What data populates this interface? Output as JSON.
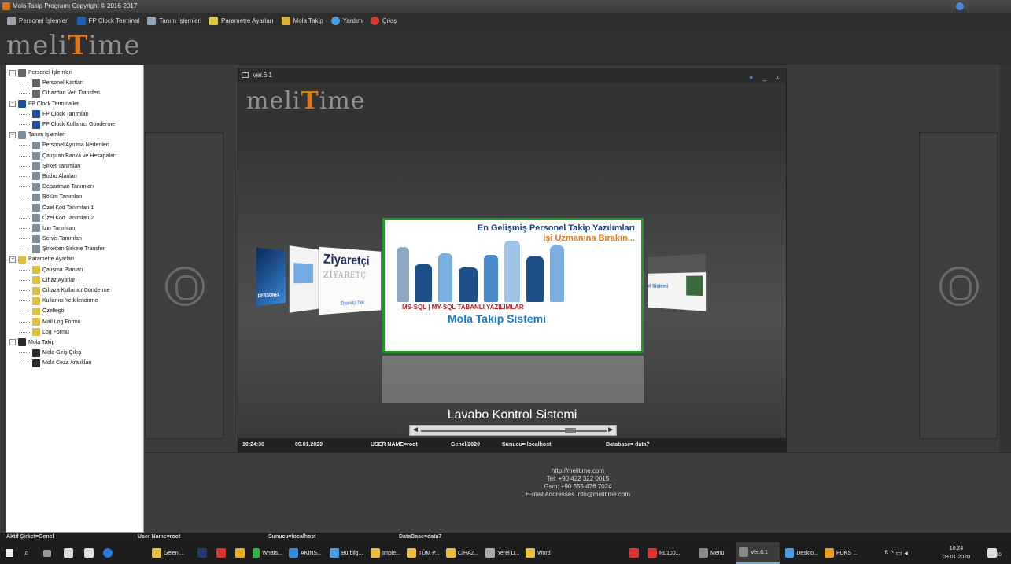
{
  "window": {
    "title": "Mola Takip Programı Copyright © 2016-2017"
  },
  "menu": [
    {
      "label": "Personel İşlemleri",
      "icon": "person-icon",
      "color": "#9aa3ad"
    },
    {
      "label": "FP Clock Terminal",
      "icon": "terminal-icon",
      "color": "#1f5fb0"
    },
    {
      "label": "Tanım İşlemleri",
      "icon": "definitions-icon",
      "color": "#8fa5b8"
    },
    {
      "label": "Parametre Ayarları",
      "icon": "folder-icon",
      "color": "#e6c34a"
    },
    {
      "label": "Mola Takip",
      "icon": "people-icon",
      "color": "#d8b03a"
    },
    {
      "label": "Yardım",
      "icon": "help-icon",
      "color": "#4a9be0"
    },
    {
      "label": "Çıkış",
      "icon": "exit-icon",
      "color": "#d83a2a"
    }
  ],
  "logo": {
    "pre": "meli",
    "t": "T",
    "post": "ime"
  },
  "tree": [
    {
      "label": "Personel İşlemleri",
      "level": 0,
      "expander": "−",
      "icon": "person-icon",
      "color": "#666"
    },
    {
      "label": "Personel Kartları",
      "level": 1,
      "icon": "person-icon",
      "color": "#666"
    },
    {
      "label": "Cihazdan Veri Transferi",
      "level": 1,
      "icon": "person-icon",
      "color": "#666"
    },
    {
      "label": "FP Clock Terminaller",
      "level": 0,
      "expander": "−",
      "icon": "terminal-icon",
      "color": "#1f4f9a"
    },
    {
      "label": "FP Clock Tanımları",
      "level": 1,
      "icon": "terminal-icon",
      "color": "#1f4f9a"
    },
    {
      "label": "FP Clock Kullanıcı Gönderme",
      "level": 1,
      "icon": "terminal-icon",
      "color": "#1f4f9a"
    },
    {
      "label": "Tanım İşlemleri",
      "level": 0,
      "expander": "−",
      "icon": "definitions-icon",
      "color": "#7c8e9e"
    },
    {
      "label": "Personel Ayrılma Nedenleri",
      "level": 1,
      "icon": "definitions-icon",
      "color": "#7c8e9e"
    },
    {
      "label": "Çalışılan Banka ve Hesapaları",
      "level": 1,
      "icon": "definitions-icon",
      "color": "#7c8e9e"
    },
    {
      "label": "Şirket Tanımları",
      "level": 1,
      "icon": "definitions-icon",
      "color": "#7c8e9e"
    },
    {
      "label": "Bodro Alanları",
      "level": 1,
      "icon": "definitions-icon",
      "color": "#7c8e9e"
    },
    {
      "label": "Departman Tanımları",
      "level": 1,
      "icon": "definitions-icon",
      "color": "#7c8e9e"
    },
    {
      "label": "Bölüm Tanımları",
      "level": 1,
      "icon": "definitions-icon",
      "color": "#7c8e9e"
    },
    {
      "label": "Özel Kod Tanımları 1",
      "level": 1,
      "icon": "definitions-icon",
      "color": "#7c8e9e"
    },
    {
      "label": "Özel Kod Tanımları 2",
      "level": 1,
      "icon": "definitions-icon",
      "color": "#7c8e9e"
    },
    {
      "label": "İzin Tanımları",
      "level": 1,
      "icon": "definitions-icon",
      "color": "#7c8e9e"
    },
    {
      "label": "Servis Tanımları",
      "level": 1,
      "icon": "definitions-icon",
      "color": "#7c8e9e"
    },
    {
      "label": "Şirketten Şirkete Transfer",
      "level": 1,
      "icon": "definitions-icon",
      "color": "#7c8e9e"
    },
    {
      "label": "Parametre Ayarları",
      "level": 0,
      "expander": "−",
      "icon": "folder-icon",
      "color": "#e0bd45"
    },
    {
      "label": "Çalışma Planları",
      "level": 1,
      "icon": "folder-icon",
      "color": "#e0bd45"
    },
    {
      "label": "Cihaz Ayarları",
      "level": 1,
      "icon": "folder-icon",
      "color": "#e0bd45"
    },
    {
      "label": "Cihaza Kullanıcı Gönderme",
      "level": 1,
      "icon": "folder-icon",
      "color": "#e0bd45"
    },
    {
      "label": "Kullanıcı Yetkilendirme",
      "level": 1,
      "icon": "folder-icon",
      "color": "#e0bd45"
    },
    {
      "label": "Özellegti",
      "level": 1,
      "icon": "folder-icon",
      "color": "#e0bd45"
    },
    {
      "label": "Mail Log Formu",
      "level": 1,
      "icon": "folder-icon",
      "color": "#e0bd45"
    },
    {
      "label": "Log Formu",
      "level": 1,
      "icon": "folder-icon",
      "color": "#e0bd45"
    },
    {
      "label": "Mola Takip",
      "level": 0,
      "expander": "−",
      "icon": "people-icon",
      "color": "#2a2a2a"
    },
    {
      "label": "Mola Giriş Çıkış",
      "level": 1,
      "icon": "people-icon",
      "color": "#2a2a2a"
    },
    {
      "label": "Mola Ceza Aralıkları",
      "level": 1,
      "icon": "people-icon",
      "color": "#2a2a2a"
    }
  ],
  "dialog": {
    "title": "Ver.6.1",
    "carousel": {
      "left_card_1": "PERSONEL",
      "left_card_2": "Ziyaretçi",
      "left_card_2_sub": "ZİYARETÇ",
      "left_card_2_caption": "Ziyaretçi Takı",
      "right_card": "el Sistemi",
      "center_title": "En Gelişmiş Personel Takip Yazılımları",
      "center_subtitle": "İşi Uzmanına Bırakın...",
      "center_ms": "MS-SQL | MY-SQL TABANLI YAZILIMLAR",
      "center_product": "Mola Takip Sistemi",
      "caption": "Lavabo Kontrol Sistemi"
    },
    "status": {
      "time": "10:24:30",
      "date": "09.01.2020",
      "user": "USER NAME=root",
      "period": "Genel/2020",
      "server": "Sunucu= localhost",
      "database": "Database= data7"
    }
  },
  "contact": {
    "web": "http://melitime.com",
    "tel": "Tel: +90 422 322 0015",
    "gsm": "Gsm: +90 555 476 7024",
    "email": "E-mail Addresses Info@melitime.com"
  },
  "app_status": {
    "company": "Aktif Şirket=Genel",
    "user": "User Name=root",
    "server": "Sunucu=localhost",
    "database": "DataBase=data7"
  },
  "taskbar": {
    "items": [
      {
        "label": "Gelen ...",
        "icon": "folder-mail-icon",
        "color": "#e8c040"
      },
      {
        "label": "",
        "icon": "photoshop-icon",
        "color": "#1e3a6e"
      },
      {
        "label": "",
        "icon": "gmail-icon",
        "color": "#d33"
      },
      {
        "label": "",
        "icon": "chrome-icon",
        "color": "#e8b020"
      },
      {
        "label": "Whats...",
        "icon": "whatsapp-icon",
        "color": "#2cb742"
      },
      {
        "label": "AKINS...",
        "icon": "network-icon",
        "color": "#3a8ad8"
      },
      {
        "label": "Bu bilg...",
        "icon": "computer-icon",
        "color": "#4a9be0"
      },
      {
        "label": "Imple...",
        "icon": "folder-icon",
        "color": "#e8c040"
      },
      {
        "label": "TÜM P...",
        "icon": "folder-icon",
        "color": "#e8c040"
      },
      {
        "label": "CİHAZ...",
        "icon": "folder-icon",
        "color": "#e8c040"
      },
      {
        "label": "Yerel D...",
        "icon": "drive-icon",
        "color": "#aaa"
      },
      {
        "label": "Word",
        "icon": "folder-icon",
        "color": "#e8c040"
      },
      {
        "label": "",
        "icon": "app-red-icon",
        "color": "#d33"
      },
      {
        "label": "RL100...",
        "icon": "dx-icon",
        "color": "#d33"
      },
      {
        "label": "Menu",
        "icon": "window-icon",
        "color": "#888"
      },
      {
        "label": "Ver.6.1",
        "icon": "window-icon",
        "color": "#888"
      },
      {
        "label": "Deskto...",
        "icon": "desktop-icon",
        "color": "#4a9be0"
      },
      {
        "label": "PDKS ...",
        "icon": "people-icon",
        "color": "#e8a020"
      }
    ],
    "time": "10:24",
    "date": "09.01.2020",
    "notifications": "10"
  }
}
